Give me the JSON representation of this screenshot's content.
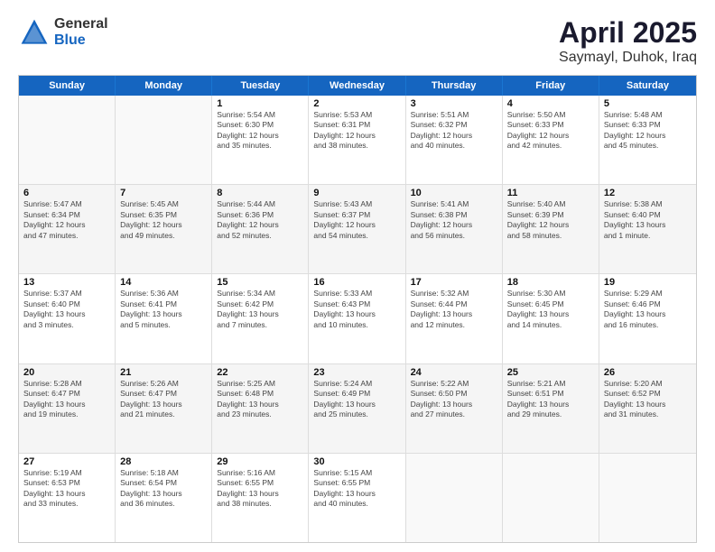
{
  "logo": {
    "general": "General",
    "blue": "Blue"
  },
  "title": {
    "month": "April 2025",
    "location": "Saymayl, Duhok, Iraq"
  },
  "header_days": [
    "Sunday",
    "Monday",
    "Tuesday",
    "Wednesday",
    "Thursday",
    "Friday",
    "Saturday"
  ],
  "weeks": [
    [
      {
        "day": "",
        "info": ""
      },
      {
        "day": "",
        "info": ""
      },
      {
        "day": "1",
        "info": "Sunrise: 5:54 AM\nSunset: 6:30 PM\nDaylight: 12 hours\nand 35 minutes."
      },
      {
        "day": "2",
        "info": "Sunrise: 5:53 AM\nSunset: 6:31 PM\nDaylight: 12 hours\nand 38 minutes."
      },
      {
        "day": "3",
        "info": "Sunrise: 5:51 AM\nSunset: 6:32 PM\nDaylight: 12 hours\nand 40 minutes."
      },
      {
        "day": "4",
        "info": "Sunrise: 5:50 AM\nSunset: 6:33 PM\nDaylight: 12 hours\nand 42 minutes."
      },
      {
        "day": "5",
        "info": "Sunrise: 5:48 AM\nSunset: 6:33 PM\nDaylight: 12 hours\nand 45 minutes."
      }
    ],
    [
      {
        "day": "6",
        "info": "Sunrise: 5:47 AM\nSunset: 6:34 PM\nDaylight: 12 hours\nand 47 minutes."
      },
      {
        "day": "7",
        "info": "Sunrise: 5:45 AM\nSunset: 6:35 PM\nDaylight: 12 hours\nand 49 minutes."
      },
      {
        "day": "8",
        "info": "Sunrise: 5:44 AM\nSunset: 6:36 PM\nDaylight: 12 hours\nand 52 minutes."
      },
      {
        "day": "9",
        "info": "Sunrise: 5:43 AM\nSunset: 6:37 PM\nDaylight: 12 hours\nand 54 minutes."
      },
      {
        "day": "10",
        "info": "Sunrise: 5:41 AM\nSunset: 6:38 PM\nDaylight: 12 hours\nand 56 minutes."
      },
      {
        "day": "11",
        "info": "Sunrise: 5:40 AM\nSunset: 6:39 PM\nDaylight: 12 hours\nand 58 minutes."
      },
      {
        "day": "12",
        "info": "Sunrise: 5:38 AM\nSunset: 6:40 PM\nDaylight: 13 hours\nand 1 minute."
      }
    ],
    [
      {
        "day": "13",
        "info": "Sunrise: 5:37 AM\nSunset: 6:40 PM\nDaylight: 13 hours\nand 3 minutes."
      },
      {
        "day": "14",
        "info": "Sunrise: 5:36 AM\nSunset: 6:41 PM\nDaylight: 13 hours\nand 5 minutes."
      },
      {
        "day": "15",
        "info": "Sunrise: 5:34 AM\nSunset: 6:42 PM\nDaylight: 13 hours\nand 7 minutes."
      },
      {
        "day": "16",
        "info": "Sunrise: 5:33 AM\nSunset: 6:43 PM\nDaylight: 13 hours\nand 10 minutes."
      },
      {
        "day": "17",
        "info": "Sunrise: 5:32 AM\nSunset: 6:44 PM\nDaylight: 13 hours\nand 12 minutes."
      },
      {
        "day": "18",
        "info": "Sunrise: 5:30 AM\nSunset: 6:45 PM\nDaylight: 13 hours\nand 14 minutes."
      },
      {
        "day": "19",
        "info": "Sunrise: 5:29 AM\nSunset: 6:46 PM\nDaylight: 13 hours\nand 16 minutes."
      }
    ],
    [
      {
        "day": "20",
        "info": "Sunrise: 5:28 AM\nSunset: 6:47 PM\nDaylight: 13 hours\nand 19 minutes."
      },
      {
        "day": "21",
        "info": "Sunrise: 5:26 AM\nSunset: 6:47 PM\nDaylight: 13 hours\nand 21 minutes."
      },
      {
        "day": "22",
        "info": "Sunrise: 5:25 AM\nSunset: 6:48 PM\nDaylight: 13 hours\nand 23 minutes."
      },
      {
        "day": "23",
        "info": "Sunrise: 5:24 AM\nSunset: 6:49 PM\nDaylight: 13 hours\nand 25 minutes."
      },
      {
        "day": "24",
        "info": "Sunrise: 5:22 AM\nSunset: 6:50 PM\nDaylight: 13 hours\nand 27 minutes."
      },
      {
        "day": "25",
        "info": "Sunrise: 5:21 AM\nSunset: 6:51 PM\nDaylight: 13 hours\nand 29 minutes."
      },
      {
        "day": "26",
        "info": "Sunrise: 5:20 AM\nSunset: 6:52 PM\nDaylight: 13 hours\nand 31 minutes."
      }
    ],
    [
      {
        "day": "27",
        "info": "Sunrise: 5:19 AM\nSunset: 6:53 PM\nDaylight: 13 hours\nand 33 minutes."
      },
      {
        "day": "28",
        "info": "Sunrise: 5:18 AM\nSunset: 6:54 PM\nDaylight: 13 hours\nand 36 minutes."
      },
      {
        "day": "29",
        "info": "Sunrise: 5:16 AM\nSunset: 6:55 PM\nDaylight: 13 hours\nand 38 minutes."
      },
      {
        "day": "30",
        "info": "Sunrise: 5:15 AM\nSunset: 6:55 PM\nDaylight: 13 hours\nand 40 minutes."
      },
      {
        "day": "",
        "info": ""
      },
      {
        "day": "",
        "info": ""
      },
      {
        "day": "",
        "info": ""
      }
    ]
  ]
}
